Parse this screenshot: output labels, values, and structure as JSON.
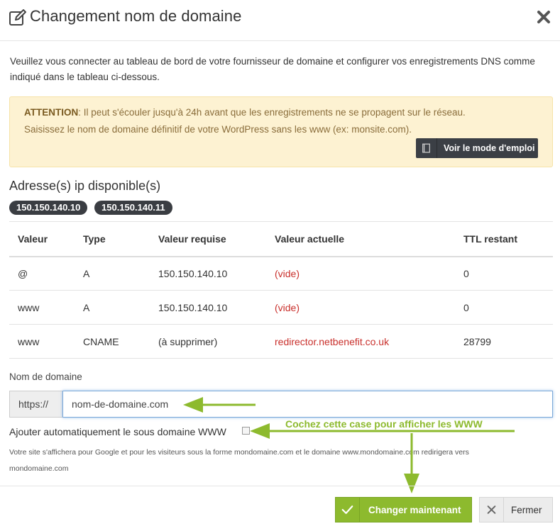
{
  "dialog": {
    "title": "Changement nom de domaine",
    "intro": "Veuillez vous connecter au tableau de bord de votre fournisseur de domaine et configurer vos enregistrements DNS comme indiqué dans le tableau ci-dessous."
  },
  "alert": {
    "label": "ATTENTION",
    "line1": ": Il peut s'écouler jusqu'à 24h avant que les enregistrements ne se propagent sur le réseau.",
    "line2": "Saisissez le nom de domaine définitif de votre WordPress sans les www (ex: monsite.com).",
    "guide_button": "Voir le mode d'emploi"
  },
  "ips": {
    "title": "Adresse(s) ip disponible(s)",
    "items": [
      "150.150.140.10",
      "150.150.140.11"
    ]
  },
  "table": {
    "headers": [
      "Valeur",
      "Type",
      "Valeur requise",
      "Valeur actuelle",
      "TTL restant"
    ],
    "rows": [
      [
        "@",
        "A",
        "150.150.140.10",
        "(vide)",
        "0"
      ],
      [
        "www",
        "A",
        "150.150.140.10",
        "(vide)",
        "0"
      ],
      [
        "www",
        "CNAME",
        "(à supprimer)",
        "redirector.netbenefit.co.uk",
        "28799"
      ]
    ]
  },
  "form": {
    "domain_label": "Nom de domaine",
    "prefix": "https://",
    "domain_value": "nom-de-domaine.com",
    "checkbox_label": "Ajouter automatiquement le sous domaine WWW",
    "checkbox_checked": false,
    "hint_line1": "Votre site s'affichera pour Google et pour les visiteurs sous la forme mondomaine.com et le domaine www.mondomaine.com redirigera vers",
    "hint_line2": "mondomaine.com"
  },
  "annotation": {
    "text": "Cochez cette case pour afficher les WWW"
  },
  "footer": {
    "submit_label": "Changer maintenant",
    "close_label": "Fermer"
  },
  "colors": {
    "accent_green": "#8dba2e",
    "alert_bg": "#fdf2d2",
    "danger_text": "#c9302c",
    "dark_badge": "#3a3d42"
  }
}
